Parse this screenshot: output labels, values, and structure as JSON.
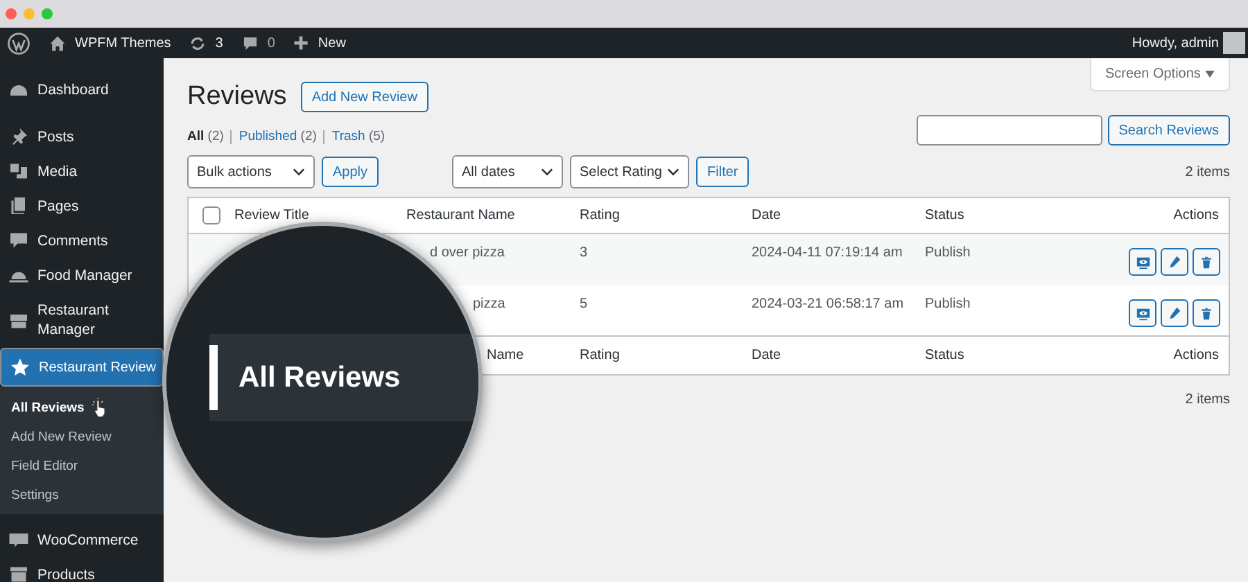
{
  "admin_bar": {
    "site": "WPFM Themes",
    "updates": "3",
    "comments": "0",
    "new": "New",
    "greeting": "Howdy, admin"
  },
  "sidebar": {
    "items": [
      {
        "label": "Dashboard",
        "selected": false
      },
      {
        "label": "Posts",
        "selected": false
      },
      {
        "label": "Media",
        "selected": false
      },
      {
        "label": "Pages",
        "selected": false
      },
      {
        "label": "Comments",
        "selected": false
      },
      {
        "label": "Food Manager",
        "selected": false
      },
      {
        "label": "Restaurant Manager",
        "selected": false
      },
      {
        "label": "Restaurant Review",
        "selected": true,
        "expanded": true,
        "children": [
          {
            "label": "All Reviews",
            "selected": true
          },
          {
            "label": "Add New Review",
            "selected": false
          },
          {
            "label": "Field Editor",
            "selected": false
          },
          {
            "label": "Settings",
            "selected": false
          }
        ]
      },
      {
        "label": "WooCommerce",
        "selected": false
      },
      {
        "label": "Products",
        "selected": false
      }
    ]
  },
  "screen_options": "Screen Options",
  "page_title": "Reviews",
  "add_button": "Add New Review",
  "views": [
    {
      "label": "All",
      "count": "(2)",
      "selected": true
    },
    {
      "label": "Published",
      "count": "(2)",
      "selected": false
    },
    {
      "label": "Trash",
      "count": "(5)",
      "selected": false
    }
  ],
  "search_button": "Search Reviews",
  "filters": {
    "bulk": "Bulk actions",
    "apply": "Apply",
    "dates": "All dates",
    "rating": "Select Rating",
    "filter": "Filter"
  },
  "items_count_top": "2 items",
  "table": {
    "select_all": {
      "checked": false
    },
    "columns": [
      "Review Title",
      "Restaurant Name",
      "Rating",
      "Date",
      "Status",
      "Actions"
    ],
    "rows": [
      {
        "restaurant": "d over pizza",
        "rating": "3",
        "date": "2024-04-11 07:19:14 am",
        "status": "Publish"
      },
      {
        "restaurant": "pizza",
        "rating": "5",
        "date": "2024-03-21 06:58:17 am",
        "status": "Publish"
      }
    ],
    "footer": [
      "Name",
      "Rating",
      "Date",
      "Status",
      "Actions"
    ]
  },
  "items_count_bottom": "2 items",
  "magnifier": {
    "label": "All Reviews"
  }
}
